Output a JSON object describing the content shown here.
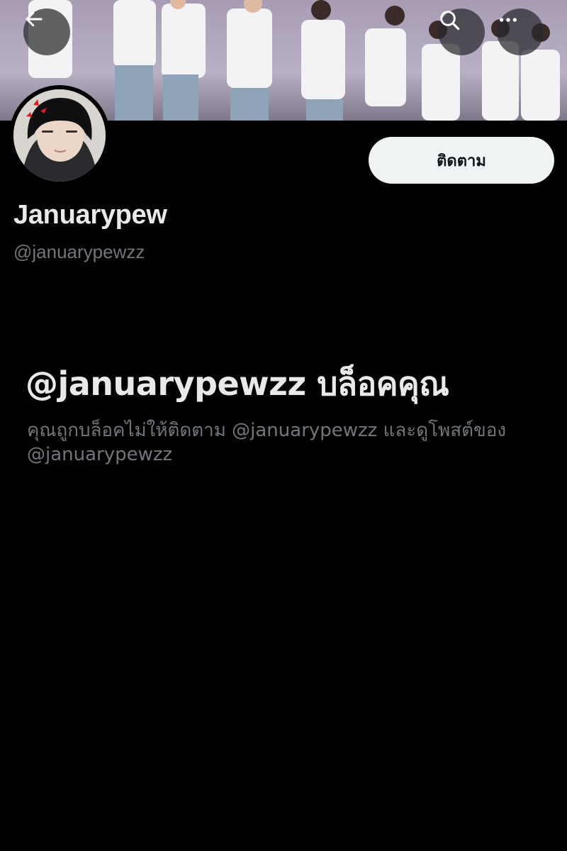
{
  "header": {
    "back_icon": "arrow-left-icon",
    "search_icon": "search-icon",
    "more_icon": "more-horizontal-icon"
  },
  "profile": {
    "display_name": "Januarypew",
    "handle": "@januarypewzz",
    "follow_label": "ติดตาม"
  },
  "blocked": {
    "title": "@januarypewzz บล็อคคุณ",
    "description": "คุณถูกบล็อคไม่ให้ติดตาม @januarypewzz และดูโพสต์ของ @januarypewzz"
  },
  "colors": {
    "background": "#000000",
    "primary_text": "#e7e9ea",
    "secondary_text": "#71767b",
    "button_bg": "#eff3f4"
  }
}
